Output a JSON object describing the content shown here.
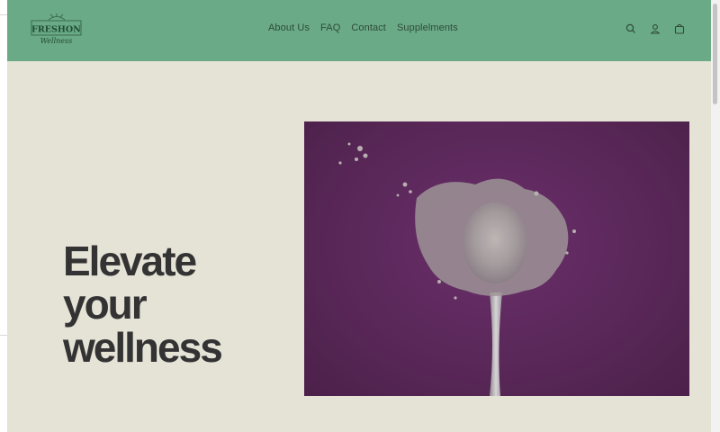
{
  "brand": {
    "name_top": "FRESHON",
    "name_bottom": "Wellness"
  },
  "nav": {
    "items": [
      {
        "label": "About Us"
      },
      {
        "label": "FAQ"
      },
      {
        "label": "Contact"
      },
      {
        "label": "Supplelments"
      }
    ]
  },
  "header_icons": [
    "search-icon",
    "account-icon",
    "cart-icon"
  ],
  "hero": {
    "title_lines": [
      "Elevate",
      "your",
      "wellness"
    ]
  },
  "colors": {
    "header_bg": "#6aaa86",
    "page_bg": "#e5e2d6",
    "hero_text": "#333333",
    "image_bg": "#5a2859"
  }
}
